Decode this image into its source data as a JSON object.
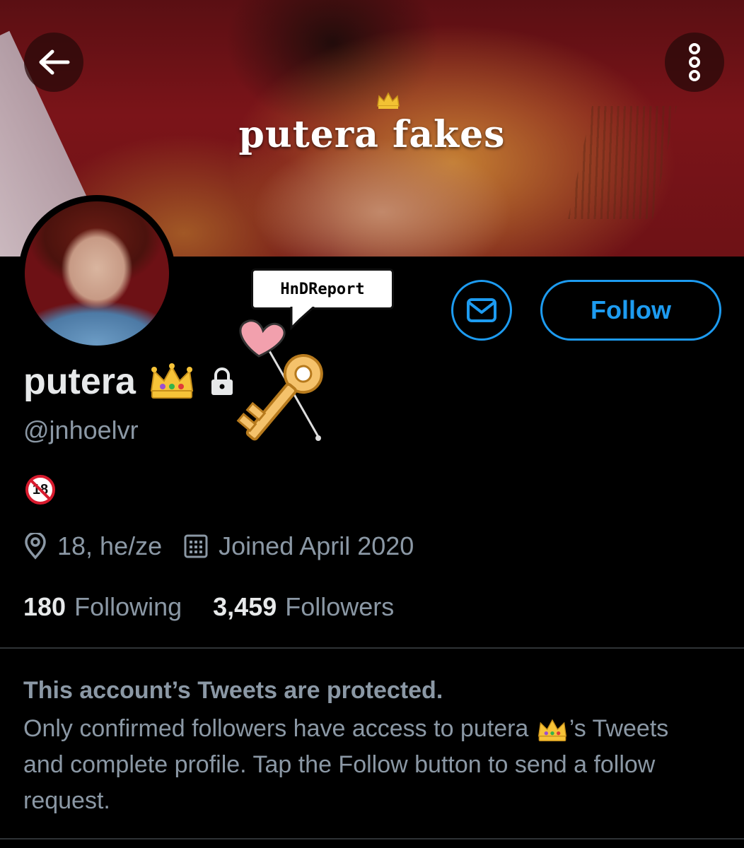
{
  "banner": {
    "title": "putera fakes"
  },
  "header": {
    "back_icon": "arrow-left-icon",
    "more_icon": "vertical-dots-icon"
  },
  "sticker": {
    "label": "HnDReport"
  },
  "actions": {
    "message_icon": "envelope-icon",
    "follow_label": "Follow",
    "accent_color": "#1d9bf0"
  },
  "profile": {
    "display_name": "putera",
    "name_emoji": "crown-icon",
    "protected_icon": "lock-icon",
    "handle": "@jnhoelvr",
    "bio_badge": "18",
    "location": "18, he/ze",
    "joined": "Joined April 2020",
    "following_count": "180",
    "following_label": "Following",
    "followers_count": "3,459",
    "followers_label": "Followers"
  },
  "protected_notice": {
    "title": "This account’s Tweets are protected.",
    "body_before": "Only confirmed followers have access to putera ",
    "body_after": "’s Tweets and complete profile. Tap the Follow button to send a follow request."
  }
}
